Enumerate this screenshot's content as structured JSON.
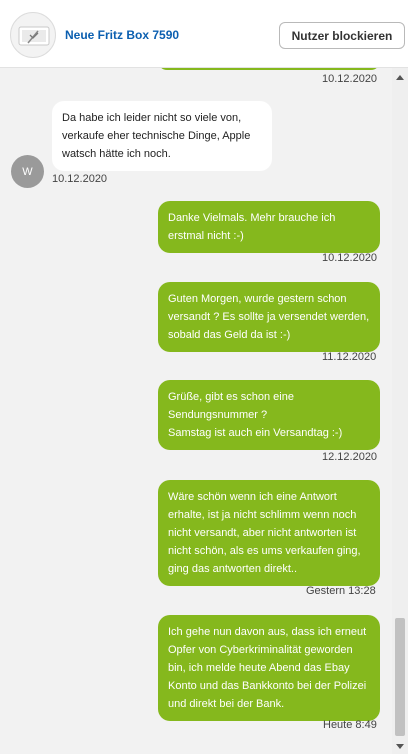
{
  "header": {
    "title": "Neue Fritz Box 7590",
    "block_button": "Nutzer blockieren"
  },
  "partner": {
    "avatar_initial": "W"
  },
  "messages": [
    {
      "direction": "out",
      "text": "",
      "time": "10.12.2020"
    },
    {
      "direction": "in",
      "text": "Da habe ich leider nicht so viele von, verkaufe eher technische Dinge, Apple watsch hätte ich noch.",
      "time": "10.12.2020"
    },
    {
      "direction": "out",
      "text": "Danke Vielmals. Mehr brauche ich erstmal nicht :-)",
      "time": "10.12.2020"
    },
    {
      "direction": "out",
      "text": "Guten Morgen, wurde gestern schon versandt ? Es sollte ja versendet werden, sobald das Geld da ist :-)",
      "time": "11.12.2020"
    },
    {
      "direction": "out",
      "text": "Grüße, gibt es schon eine Sendungsnummer ?\nSamstag ist auch ein Versandtag :-)",
      "time": "12.12.2020"
    },
    {
      "direction": "out",
      "text": "Wäre schön wenn ich eine Antwort erhalte, ist ja nicht schlimm wenn noch nicht versandt, aber nicht antworten ist nicht schön, als es ums verkaufen ging, ging das antworten direkt..",
      "time": "Gestern 13:28"
    },
    {
      "direction": "out",
      "text": "Ich gehe nun davon aus, dass ich erneut Opfer von Cyberkriminalität geworden bin, ich melde heute Abend das Ebay Konto und das Bankkonto bei der Polizei und direkt bei der Bank.",
      "time": "Heute 8:49"
    }
  ],
  "colors": {
    "outgoing_bubble": "#85b81d",
    "incoming_bubble": "#ffffff",
    "chat_background": "#f2f2f2",
    "title_link": "#0b5fb0"
  },
  "icons": {
    "listing_thumbnail": "fritzbox-thumbnail-icon",
    "scroll_up": "arrow-up-icon",
    "scroll_down": "arrow-down-icon"
  }
}
